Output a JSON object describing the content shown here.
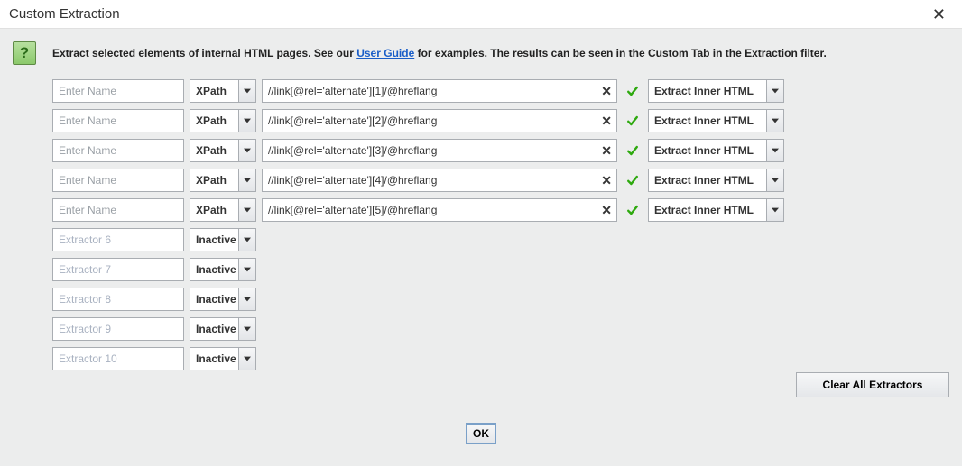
{
  "title": "Custom Extraction",
  "intro": {
    "prefix": "Extract selected elements of internal HTML pages. See our ",
    "link": "User Guide",
    "suffix": " for examples. The results can be seen in the Custom Tab in the Extraction filter."
  },
  "placeholders": {
    "name": "Enter Name"
  },
  "combos": {
    "type_label": "XPath",
    "inactive_label": "Inactive",
    "output_label": "Extract Inner HTML"
  },
  "rows_active": [
    {
      "name": "",
      "xpath": "//link[@rel='alternate'][1]/@hreflang"
    },
    {
      "name": "",
      "xpath": "//link[@rel='alternate'][2]/@hreflang"
    },
    {
      "name": "",
      "xpath": "//link[@rel='alternate'][3]/@hreflang"
    },
    {
      "name": "",
      "xpath": "//link[@rel='alternate'][4]/@hreflang"
    },
    {
      "name": "",
      "xpath": "//link[@rel='alternate'][5]/@hreflang"
    }
  ],
  "rows_inactive": [
    {
      "name": "Extractor 6"
    },
    {
      "name": "Extractor 7"
    },
    {
      "name": "Extractor 8"
    },
    {
      "name": "Extractor 9"
    },
    {
      "name": "Extractor 10"
    }
  ],
  "buttons": {
    "clear_all": "Clear All Extractors",
    "ok": "OK"
  }
}
